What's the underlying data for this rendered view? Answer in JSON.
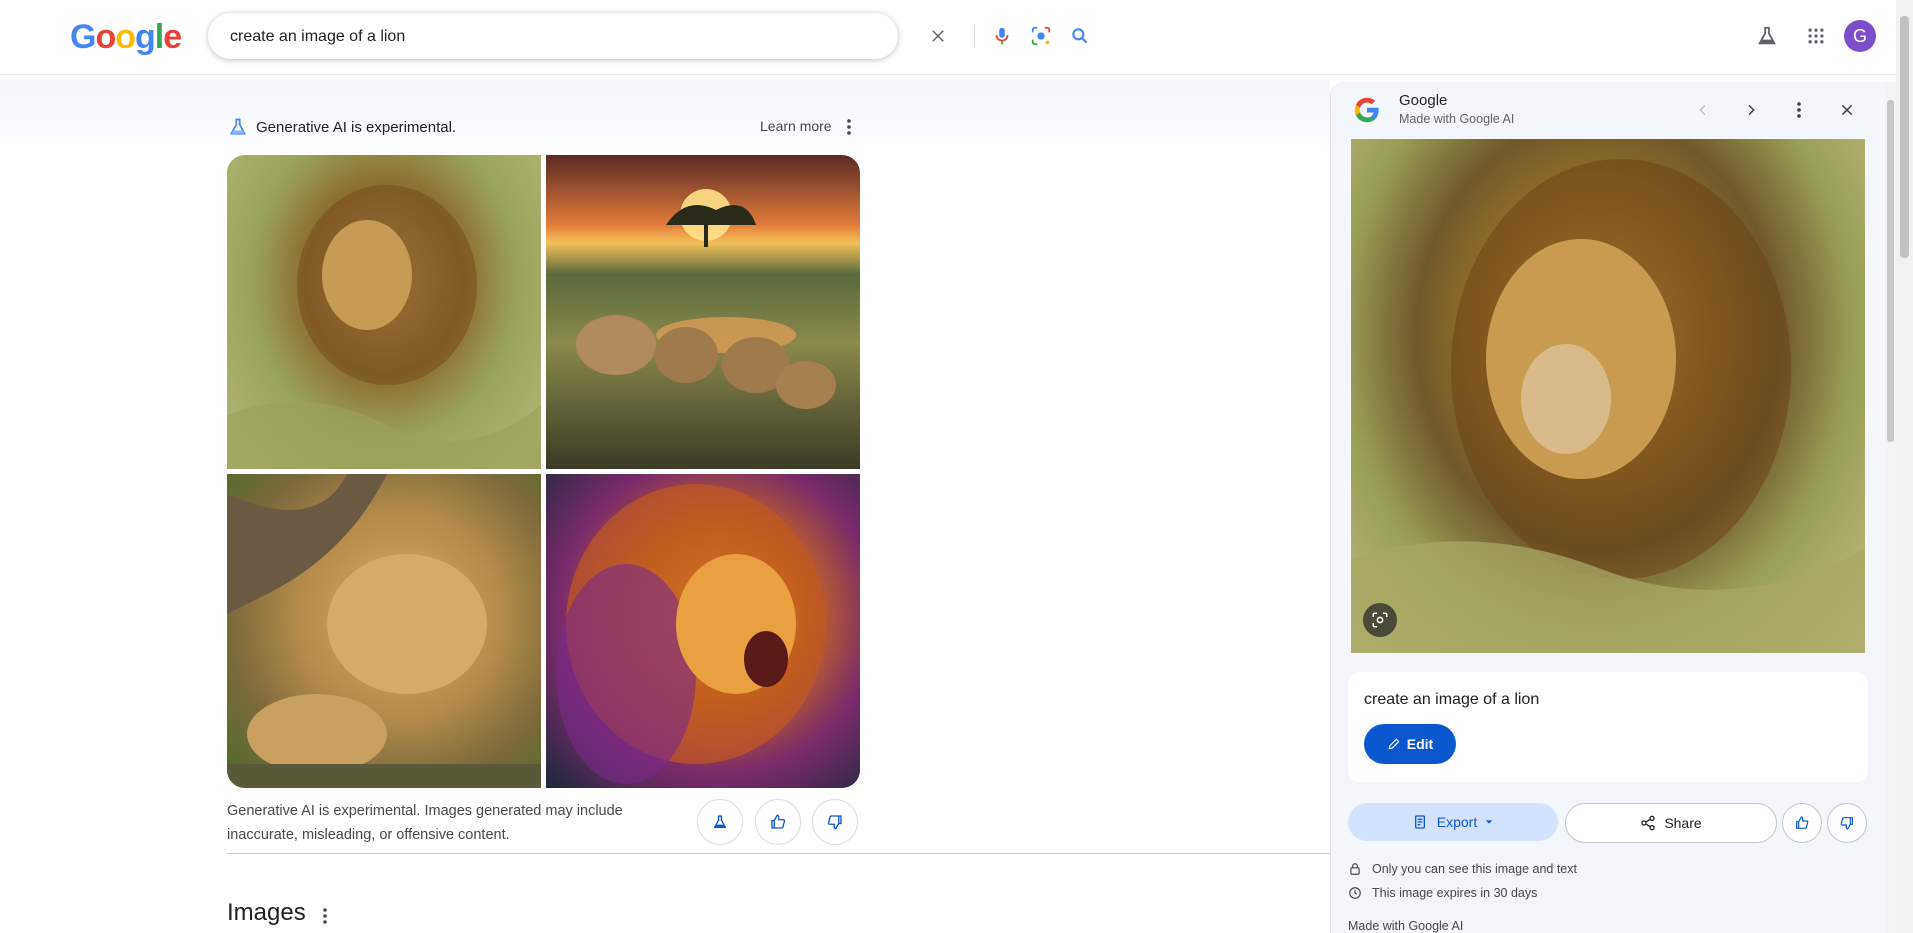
{
  "header": {
    "logo_letters": [
      "G",
      "o",
      "o",
      "g",
      "l",
      "e"
    ],
    "logo_colors": [
      "#4285F4",
      "#EA4335",
      "#FBBC05",
      "#4285F4",
      "#34A853",
      "#EA4335"
    ],
    "search_value": "create an image of a lion",
    "avatar_letter": "G"
  },
  "ai_overview": {
    "note": "Generative AI is experimental.",
    "learn_more": "Learn more",
    "disclaimer": "Generative AI is experimental. Images generated may include inaccurate, misleading, or offensive content."
  },
  "images_section": {
    "heading": "Images"
  },
  "panel": {
    "source_title": "Google",
    "source_subtitle": "Made with Google AI",
    "prompt": "create an image of a lion",
    "edit_label": "Edit",
    "export_label": "Export",
    "share_label": "Share",
    "privacy_note": "Only you can see this image and text",
    "expiry_note": "This image expires in 30 days",
    "footer": "Made with Google AI"
  },
  "colors": {
    "accent_blue": "#0b57d0",
    "export_bg": "#d3e3fd",
    "avatar_bg": "#7b4fc9"
  }
}
